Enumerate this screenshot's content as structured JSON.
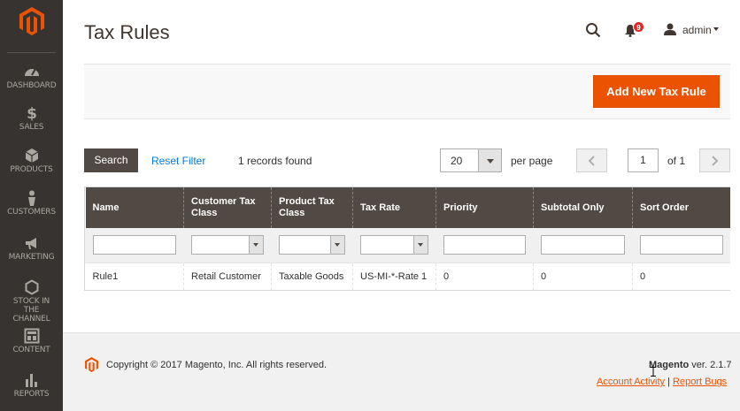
{
  "sidebar": {
    "items": [
      {
        "label": "DASHBOARD",
        "icon": "dashboard-icon"
      },
      {
        "label": "SALES",
        "icon": "dollar-icon"
      },
      {
        "label": "PRODUCTS",
        "icon": "box-icon"
      },
      {
        "label": "CUSTOMERS",
        "icon": "person-icon"
      },
      {
        "label": "MARKETING",
        "icon": "megaphone-icon"
      },
      {
        "label": "STOCK IN THE CHANNEL",
        "icon": "hexagon-icon"
      },
      {
        "label": "CONTENT",
        "icon": "layout-icon"
      },
      {
        "label": "REPORTS",
        "icon": "bar-chart-icon"
      }
    ]
  },
  "header": {
    "title": "Tax Rules",
    "notification_count": "9",
    "user": "admin"
  },
  "actions": {
    "add_label": "Add New Tax Rule"
  },
  "grid_controls": {
    "search_label": "Search",
    "reset_label": "Reset Filter",
    "records_text": "1 records found",
    "per_page_value": "20",
    "per_page_label": "per page",
    "page_value": "1",
    "page_of": "of 1"
  },
  "table": {
    "columns": [
      "Name",
      "Customer Tax Class",
      "Product Tax Class",
      "Tax Rate",
      "Priority",
      "Subtotal Only",
      "Sort Order"
    ],
    "rows": [
      [
        "Rule1",
        "Retail Customer",
        "Taxable Goods",
        "US-MI-*-Rate 1",
        "0",
        "0",
        "0"
      ]
    ]
  },
  "footer": {
    "copyright": "Copyright © 2017 Magento, Inc. All rights reserved.",
    "brand": "Magento",
    "version": " ver. 2.1.7",
    "account_activity": "Account Activity",
    "separator": "|",
    "report_bugs": "Report Bugs"
  },
  "colors": {
    "accent": "#eb5202",
    "sidebar": "#373330",
    "header_row": "#514943",
    "link": "#007bdb"
  }
}
